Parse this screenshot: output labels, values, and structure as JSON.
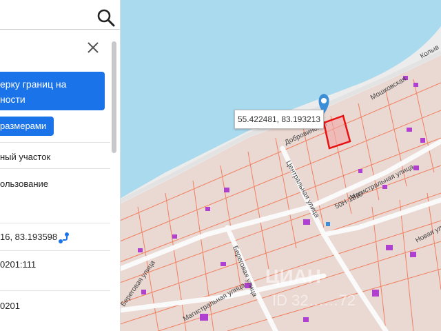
{
  "search": {
    "placeholder": ""
  },
  "panel": {
    "action_button_line1": "ерку границ на",
    "action_button_line2": "ности",
    "sizes_button": "размерами",
    "rows": {
      "type": "ный участок",
      "use": "ользование",
      "coords": "16, 83.193598",
      "cadastral1": "0201:111",
      "cadastral2": "0201"
    }
  },
  "map": {
    "popup_coords": "55.422481, 83.193213",
    "labels": {
      "street_tsentralnaya": "Центральная улица",
      "street_magistralnaya": "Магистральная улица",
      "road_code": "50Н-1910",
      "street_beregovaya": "Береговая улица",
      "street_magistralnaya2": "Магистральная улица",
      "street_novaya": "Новая улица",
      "street_dobrovinskiy": "Добровинский",
      "street_beregovaya2": "Береговая улица",
      "street_kolyvan": "Колыв",
      "street_moshkovskaya": "Мошковская",
      "street_tsentralnaya2": "Центральная"
    },
    "watermark": "ЦИАН",
    "watermark_id": "ID 32……72",
    "colors": {
      "water": "#aadaee",
      "plot_line": "#f08060",
      "plot_fill": "#ead8d2",
      "selected": "#e81010",
      "building": "#b040d0",
      "pin": "#3b8fd8"
    }
  }
}
